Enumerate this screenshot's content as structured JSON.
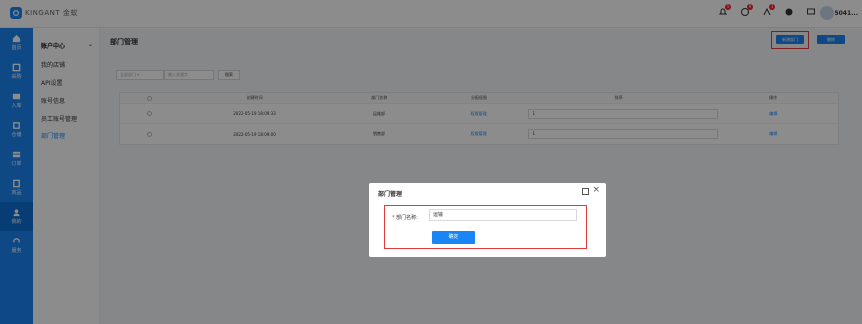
{
  "brand": {
    "name": "KINGANT 金蚁"
  },
  "topbar": {
    "badges": [
      "5",
      "9",
      "3"
    ],
    "user": "5041..."
  },
  "rail": [
    {
      "label": "首页",
      "icon": "home-icon"
    },
    {
      "label": "采购",
      "icon": "purchase-icon"
    },
    {
      "label": "入库",
      "icon": "inbound-icon"
    },
    {
      "label": "仓储",
      "icon": "warehouse-icon"
    },
    {
      "label": "订单",
      "icon": "order-icon"
    },
    {
      "label": "商品",
      "icon": "goods-icon"
    },
    {
      "label": "我的",
      "icon": "user-icon"
    },
    {
      "label": "服务",
      "icon": "service-icon"
    }
  ],
  "submenu": {
    "head": "账户中心",
    "items": [
      "我的店铺",
      "API设置",
      "账号信息",
      "员工账号管理",
      "部门管理"
    ]
  },
  "main": {
    "title": "部门管理",
    "add_btn": "新增部门",
    "del_btn": "删除",
    "filter_select": "全部部门",
    "filter_placeholder": "输入关键字",
    "filter_btn": "搜索",
    "columns": [
      "创建时间",
      "部门名称",
      "分配权限",
      "排序",
      "操作"
    ],
    "rows": [
      {
        "time": "2022-05-19 18:09:33",
        "name": "运维部",
        "perm": "权限管理",
        "sort": "1",
        "op": "编辑"
      },
      {
        "time": "2022-05-19 18:09:00",
        "name": "销售部",
        "perm": "权限管理",
        "sort": "1",
        "op": "编辑"
      }
    ]
  },
  "modal": {
    "title": "部门管理",
    "field_label": "部门名称:",
    "field_value": "运输",
    "submit": "确定"
  }
}
